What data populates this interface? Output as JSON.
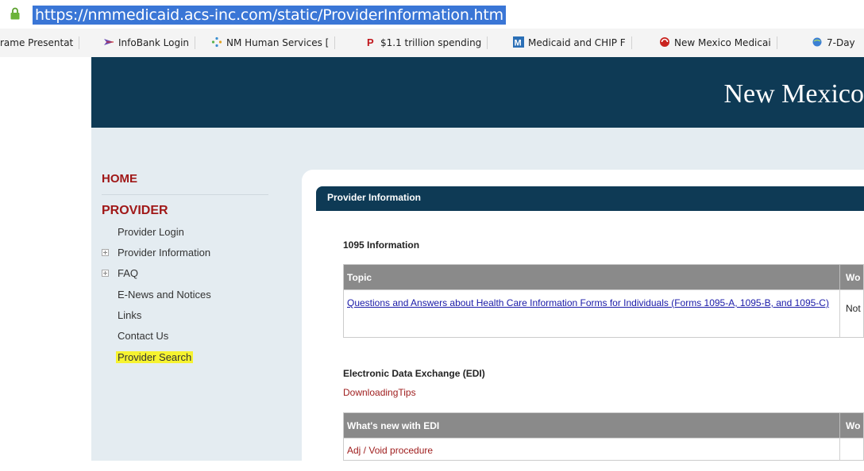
{
  "browser": {
    "url": "https://nmmedicaid.acs-inc.com/static/ProviderInformation.htm",
    "bookmarks": [
      {
        "label": "rame Presentat",
        "icon": "page-icon"
      },
      {
        "label": "InfoBank Login",
        "icon": "infobank-icon"
      },
      {
        "label": "NM Human Services [",
        "icon": "nm-human-services-icon"
      },
      {
        "label": "$1.1 trillion spending",
        "icon": "p-icon"
      },
      {
        "label": "Medicaid and CHIP F",
        "icon": "m-icon"
      },
      {
        "label": "New Mexico Medicai",
        "icon": "nm-medicaid-icon"
      },
      {
        "label": "7-Day",
        "icon": "globe-icon"
      }
    ]
  },
  "header": {
    "title": "New Mexico"
  },
  "sidebar": {
    "home": "HOME",
    "provider_heading": "PROVIDER",
    "items": [
      {
        "label": "Provider Login",
        "expandable": false
      },
      {
        "label": "Provider Information",
        "expandable": true
      },
      {
        "label": "FAQ",
        "expandable": true
      },
      {
        "label": "E-News and Notices",
        "expandable": false
      },
      {
        "label": "Links",
        "expandable": false
      },
      {
        "label": "Contact Us",
        "expandable": false
      },
      {
        "label": "Provider Search",
        "expandable": false,
        "highlighted": true
      }
    ]
  },
  "main": {
    "panel_title": "Provider Information",
    "section_1095": {
      "title": "1095 Information",
      "columns": [
        "Topic",
        "Wo"
      ],
      "rows": [
        {
          "topic": "Questions and Answers about Health Care Information Forms for Individuals (Forms 1095-A, 1095-B, and 1095-C)",
          "right": "Not"
        }
      ]
    },
    "section_edi": {
      "title": "Electronic Data Exchange (EDI)",
      "tips_link": "DownloadingTips",
      "columns": [
        "What's new with EDI",
        "Wo"
      ],
      "rows": [
        {
          "topic": "Adj / Void procedure"
        }
      ]
    }
  },
  "colors": {
    "header_navy": "#0e3a55",
    "nav_red": "#a01818",
    "highlight_yellow": "#f6f330",
    "url_selection": "#3a76d6"
  }
}
